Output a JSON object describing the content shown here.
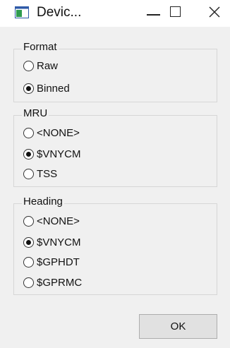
{
  "window": {
    "title": "Devic...",
    "icon": "app-window-icon",
    "controls": [
      "minimize-icon",
      "maximize-icon",
      "close-icon"
    ]
  },
  "format": {
    "legend": "Format",
    "options": [
      {
        "label": "Raw",
        "checked": false
      },
      {
        "label": "Binned",
        "checked": true
      }
    ]
  },
  "mru": {
    "legend": "MRU",
    "options": [
      {
        "label": "<NONE>",
        "checked": false
      },
      {
        "label": "$VNYCM",
        "checked": true
      },
      {
        "label": "TSS",
        "checked": false
      }
    ]
  },
  "heading": {
    "legend": "Heading",
    "options": [
      {
        "label": "<NONE>",
        "checked": false
      },
      {
        "label": "$VNYCM",
        "checked": true
      },
      {
        "label": "$GPHDT",
        "checked": false
      },
      {
        "label": "$GPRMC",
        "checked": false
      }
    ]
  },
  "buttons": {
    "ok_label": "OK"
  },
  "colors": {
    "window_bg": "#f0f0f0",
    "titlebar_bg": "#ffffff",
    "group_border": "#d6d6d6",
    "button_bg": "#e1e1e1",
    "icon_green": "#2e9b4f",
    "icon_blue": "#2f5aa8"
  }
}
